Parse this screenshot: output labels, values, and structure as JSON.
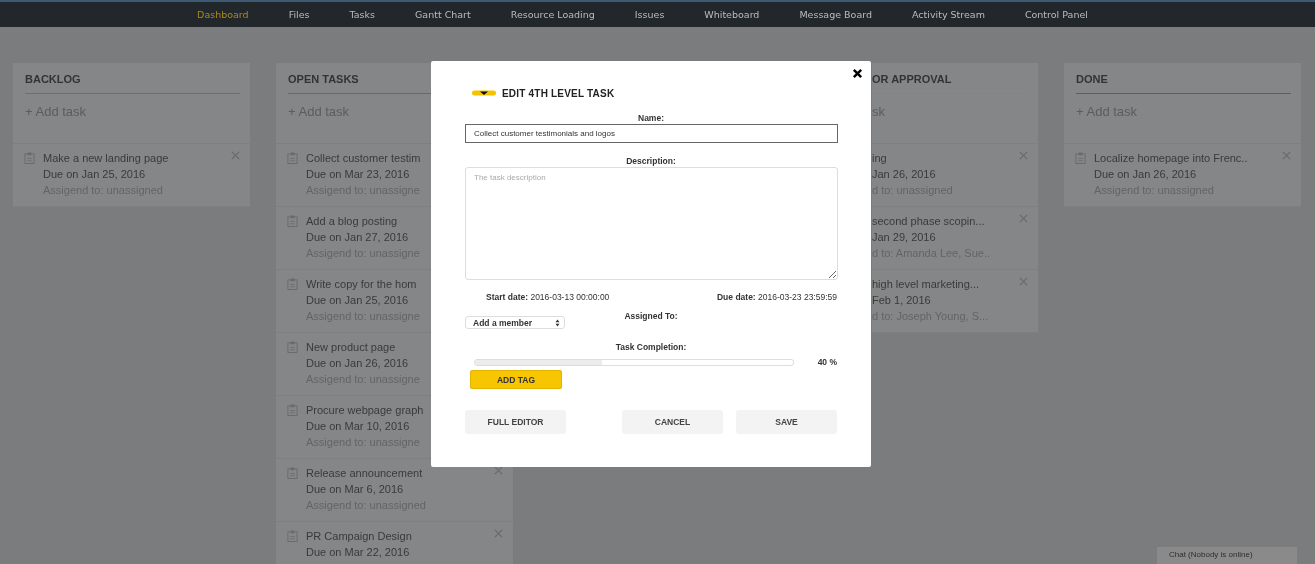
{
  "nav": [
    {
      "label": "Dashboard",
      "selected": true
    },
    {
      "label": "Files",
      "selected": false
    },
    {
      "label": "Tasks",
      "selected": false
    },
    {
      "label": "Gantt Chart",
      "selected": false
    },
    {
      "label": "Resource Loading",
      "selected": false
    },
    {
      "label": "Issues",
      "selected": false
    },
    {
      "label": "Whiteboard",
      "selected": false
    },
    {
      "label": "Message Board",
      "selected": false
    },
    {
      "label": "Activity Stream",
      "selected": false
    },
    {
      "label": "Control Panel",
      "selected": false
    }
  ],
  "columns": [
    {
      "kind": "full",
      "title": "BACKLOG",
      "color": "#6e6e6e",
      "add_task": "+ Add task",
      "cards": [
        {
          "kind": "whole",
          "title": "Make a new landing page",
          "due": "Due on Jan 25, 2016",
          "assigned": "Assigend to: unassigned"
        }
      ]
    },
    {
      "kind": "full",
      "title": "OPEN TASKS",
      "color": "#4f7a4f",
      "add_task": "+ Add task",
      "cards": [
        {
          "kind": "covered",
          "title": "Collect customer testim",
          "due": "Due on Mar 23, 2016",
          "assigned": "Assigend to: unassigne"
        },
        {
          "kind": "covered",
          "title": "Add a blog posting",
          "due": "Due on Jan 27, 2016",
          "assigned": "Assigend to: unassigne"
        },
        {
          "kind": "covered",
          "title": "Write copy for the hom",
          "due": "Due on Jan 25, 2016",
          "assigned": "Assigend to: unassigne"
        },
        {
          "kind": "covered",
          "title": "New product page",
          "due": "Due on Jan 26, 2016",
          "assigned": "Assigend to: unassigne"
        },
        {
          "kind": "covered",
          "title": "Procure webpage graph",
          "due": "Due on Mar 10, 2016",
          "assigned": "Assigend to: unassigne"
        },
        {
          "kind": "whole",
          "title": "Release announcement",
          "due": "Due on Mar 6, 2016",
          "assigned": "Assigend to: unassigned"
        },
        {
          "kind": "whole",
          "title": "PR Campaign Design",
          "due": "Due on Mar 22, 2016"
        }
      ]
    },
    {
      "kind": "clipped",
      "title": "OR APPROVAL",
      "color": "#8f8a3c",
      "add_task": "sk",
      "cards": [
        {
          "kind": "whole",
          "title": "ing",
          "due": "Jan 26, 2016",
          "assigned": "d to: unassigned"
        },
        {
          "kind": "whole",
          "title": "second phase scopin...",
          "due": "Jan 29, 2016",
          "assigned": "d to: Amanda Lee, Sue.."
        },
        {
          "kind": "whole",
          "title": "high level marketing...",
          "due": "Feb 1, 2016",
          "assigned": "d to: Joseph Young, S..."
        }
      ]
    },
    {
      "kind": "full",
      "title": "DONE",
      "color": "#555a8c",
      "add_task": "+ Add task",
      "cards": [
        {
          "kind": "whole",
          "title": "Localize homepage into Frenc..",
          "due": "Due on Jan 26, 2016",
          "assigned": "Assigend to: unassigned"
        }
      ]
    }
  ],
  "modal": {
    "title": "EDIT 4TH LEVEL TASK",
    "name_label": "Name:",
    "name_value": "Collect customer testimonials and logos",
    "description_label": "Description:",
    "description_placeholder": "The task description",
    "start_date": "**Start date:** 2016-03-13 00:00:00",
    "due_date": "**Due date:** 2016-03-23 23:59:59",
    "assigned_label": "Assigned To:",
    "member_select": "Add a member",
    "completion_label": "Task Completion:",
    "completion": {
      "level": 0.4,
      "reading": "40 %"
    },
    "add_tag": "ADD TAG",
    "buttons": [
      "FULL EDITOR",
      "CANCEL",
      "SAVE"
    ]
  },
  "chat": "Chat (Nobody is online)"
}
